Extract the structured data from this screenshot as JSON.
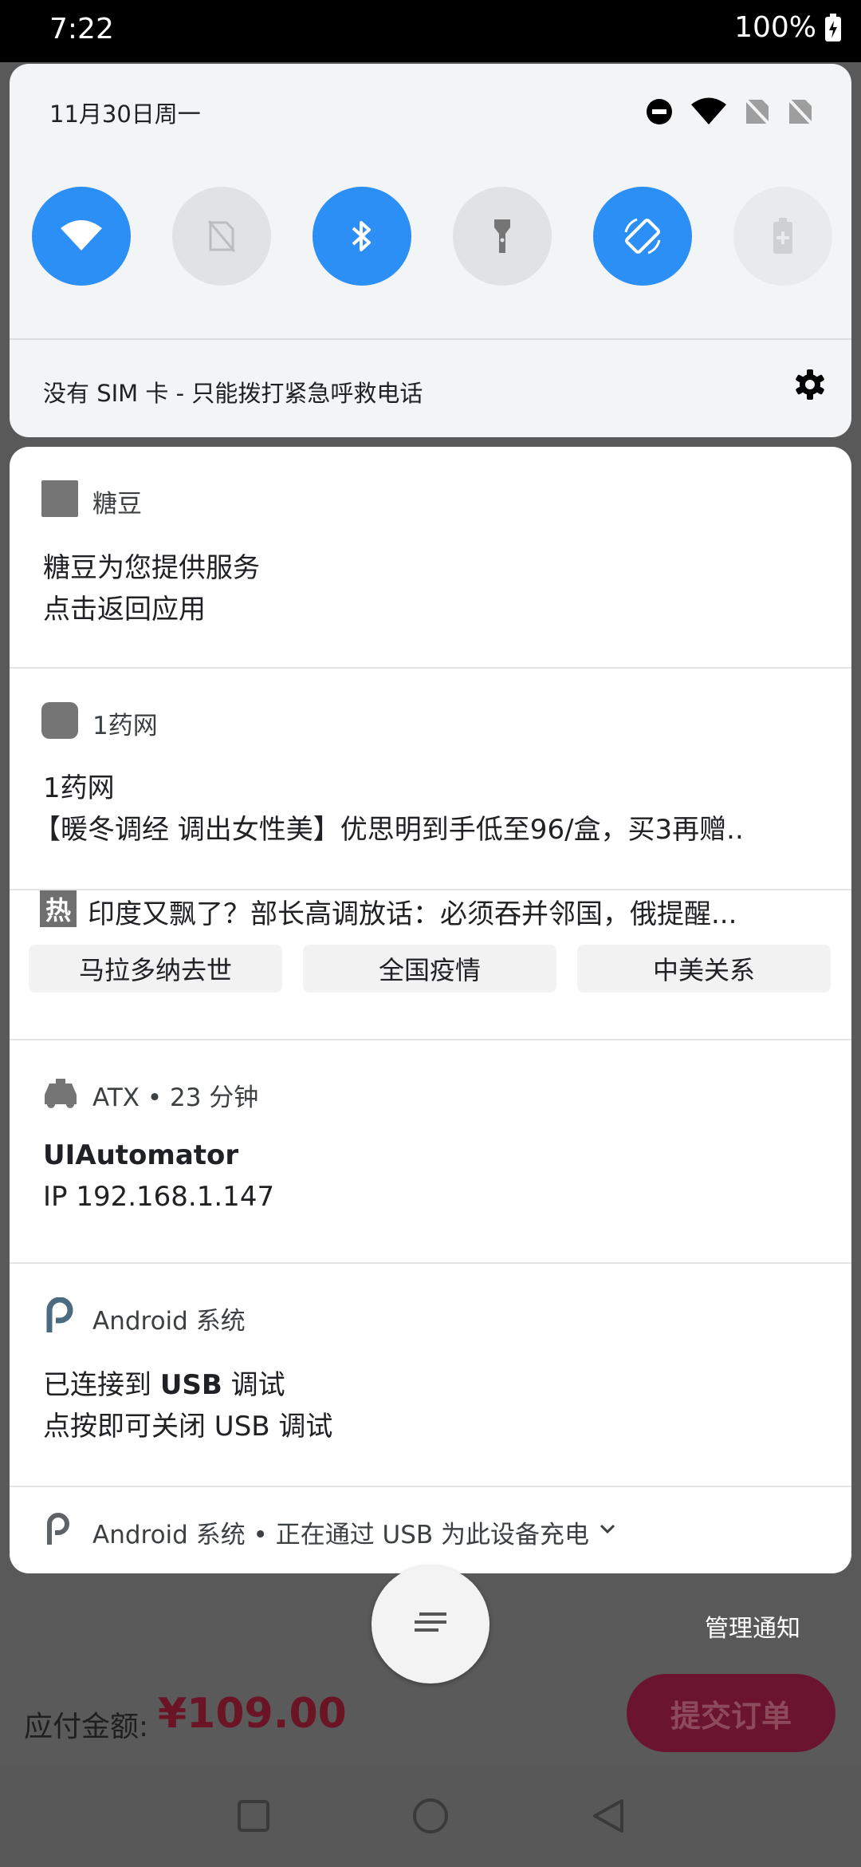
{
  "status_bar": {
    "time": "7:22",
    "battery": "100%"
  },
  "quick_settings": {
    "date": "11月30日周一",
    "tiles": [
      {
        "name": "wifi",
        "state": "on"
      },
      {
        "name": "mobile-data",
        "state": "off"
      },
      {
        "name": "bluetooth",
        "state": "on"
      },
      {
        "name": "flashlight",
        "state": "off"
      },
      {
        "name": "auto-rotate",
        "state": "on"
      },
      {
        "name": "battery-saver",
        "state": "disabled"
      }
    ],
    "sim_text": "没有 SIM 卡 - 只能拨打紧急呼救电话"
  },
  "notifications": {
    "tangdou": {
      "app": "糖豆",
      "title": "糖豆为您提供服务",
      "text": "点击返回应用"
    },
    "yaowang": {
      "app": "1药网",
      "title": "1药网",
      "text": "【暖冬调经 调出女性美】优思明到手低至96/盒，买3再赠.."
    },
    "news": {
      "hot_badge": "热",
      "headline": "印度又飘了？部长高调放话：必须吞并邻国，俄提醒...",
      "chips": [
        "马拉多纳去世",
        "全国疫情",
        "中美关系"
      ]
    },
    "atx": {
      "app": "ATX • 23 分钟",
      "title": "UIAutomator",
      "text": "IP 192.168.1.147"
    },
    "usb_debug": {
      "app": "Android 系统",
      "title_prefix": "已连接到 ",
      "title_bold": "USB",
      "title_suffix": " 调试",
      "text": "点按即可关闭 USB 调试"
    },
    "usb_charge": {
      "app": "Android 系统 • 正在通过 USB 为此设备充电"
    }
  },
  "manage_label": "管理通知",
  "background_app": {
    "amount_label": "应付金额:",
    "amount_value": "¥109.00",
    "submit_label": "提交订单"
  }
}
